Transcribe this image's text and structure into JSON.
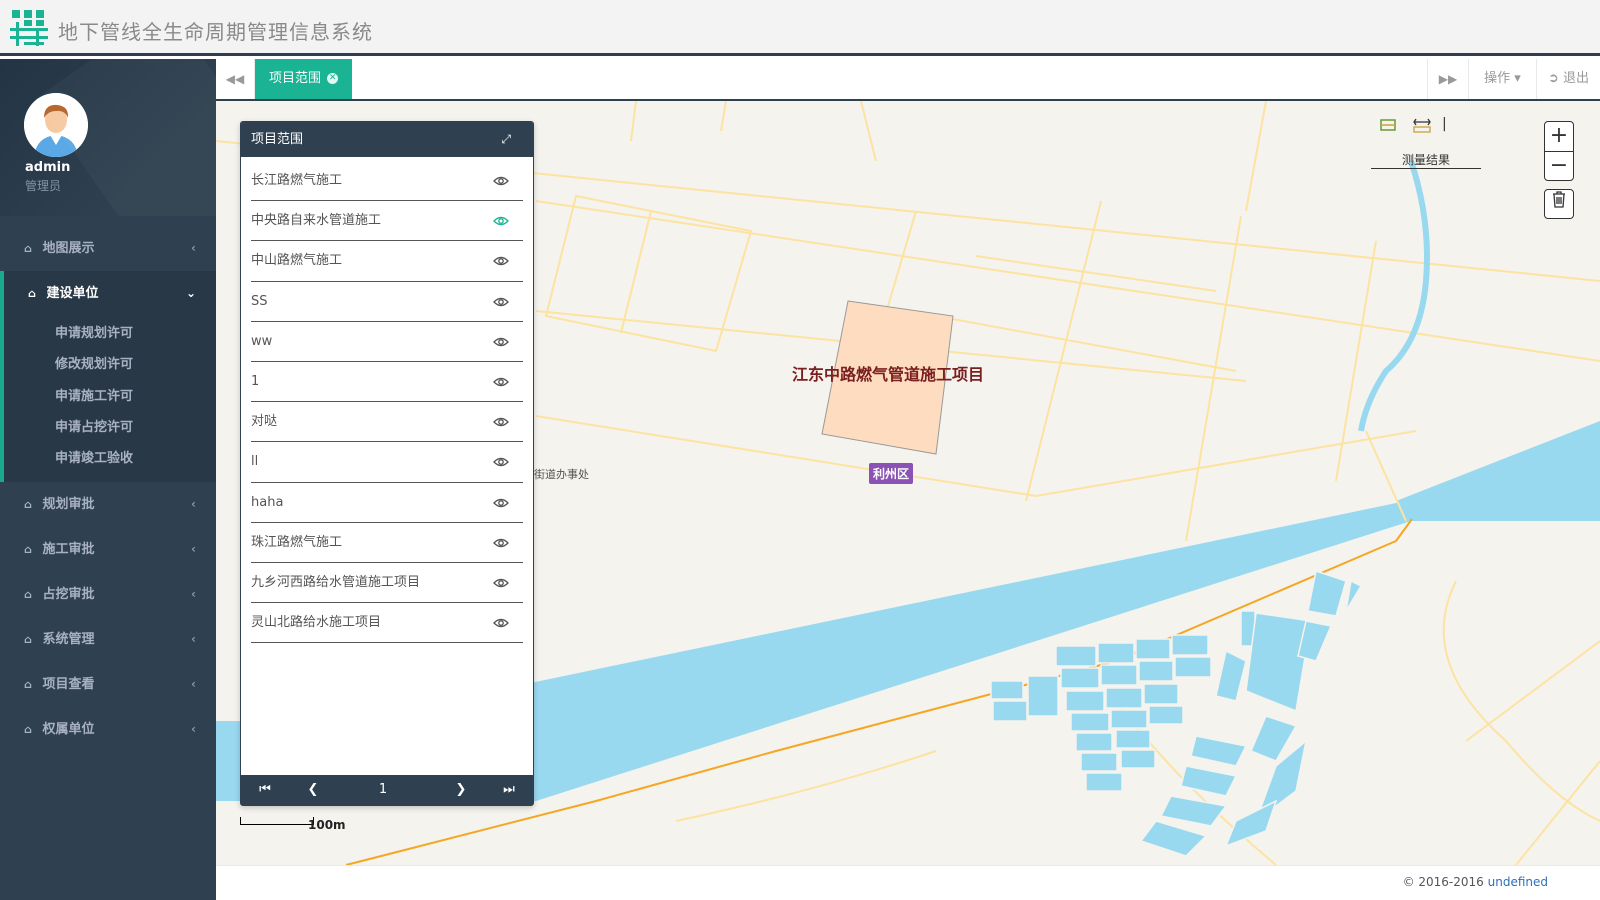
{
  "header": {
    "app_title": "地下管线全生命周期管理信息系统",
    "logo_icon": "building-grid-icon"
  },
  "sidebar": {
    "user_name": "admin",
    "user_role": "管理员",
    "menu": [
      {
        "label": "地图展示",
        "icon": "home-icon",
        "expanded": false
      },
      {
        "label": "建设单位",
        "icon": "home-icon",
        "expanded": true,
        "children": [
          "申请规划许可",
          "修改规划许可",
          "申请施工许可",
          "申请占挖许可",
          "申请竣工验收"
        ]
      },
      {
        "label": "规划审批",
        "icon": "home-icon",
        "expanded": false
      },
      {
        "label": "施工审批",
        "icon": "home-icon",
        "expanded": false
      },
      {
        "label": "占挖审批",
        "icon": "home-icon",
        "expanded": false
      },
      {
        "label": "系统管理",
        "icon": "home-icon",
        "expanded": false
      },
      {
        "label": "项目查看",
        "icon": "home-icon",
        "expanded": false
      },
      {
        "label": "权属单位",
        "icon": "home-icon",
        "expanded": false
      }
    ]
  },
  "tabs": {
    "active_label": "项目范围",
    "operations_label": "操作",
    "exit_label": "退出"
  },
  "panel": {
    "title": "项目范围",
    "items": [
      {
        "name": "长江路燃气施工",
        "visible_highlight": false
      },
      {
        "name": "中央路自来水管道施工",
        "visible_highlight": true
      },
      {
        "name": "中山路燃气施工",
        "visible_highlight": false
      },
      {
        "name": "SS",
        "visible_highlight": false
      },
      {
        "name": "ww",
        "visible_highlight": false
      },
      {
        "name": "1",
        "visible_highlight": false
      },
      {
        "name": "对哒",
        "visible_highlight": false
      },
      {
        "name": "ll",
        "visible_highlight": false
      },
      {
        "name": "haha",
        "visible_highlight": false
      },
      {
        "name": "珠江路燃气施工",
        "visible_highlight": false
      },
      {
        "name": "九乡河西路给水管道施工项目",
        "visible_highlight": false
      },
      {
        "name": "灵山北路给水施工项目",
        "visible_highlight": false
      }
    ],
    "pager": {
      "current_page": "1"
    }
  },
  "map": {
    "project_label": "江东中路燃气管道施工项目",
    "district_label": "利州区",
    "street_office_label": "街道办事处",
    "scale_label": "100m",
    "measure_result_label": "测量结果",
    "colors": {
      "water": "#99d9f0",
      "land": "#f5f3ee",
      "road": "#fde3a2",
      "highway": "#f5a623",
      "project_fill": "#fddcc0",
      "accent": "#1ab394",
      "sidebar": "#2f4050"
    }
  },
  "footer": {
    "copyright": "© 2016-2016 ",
    "link": "undefined"
  }
}
